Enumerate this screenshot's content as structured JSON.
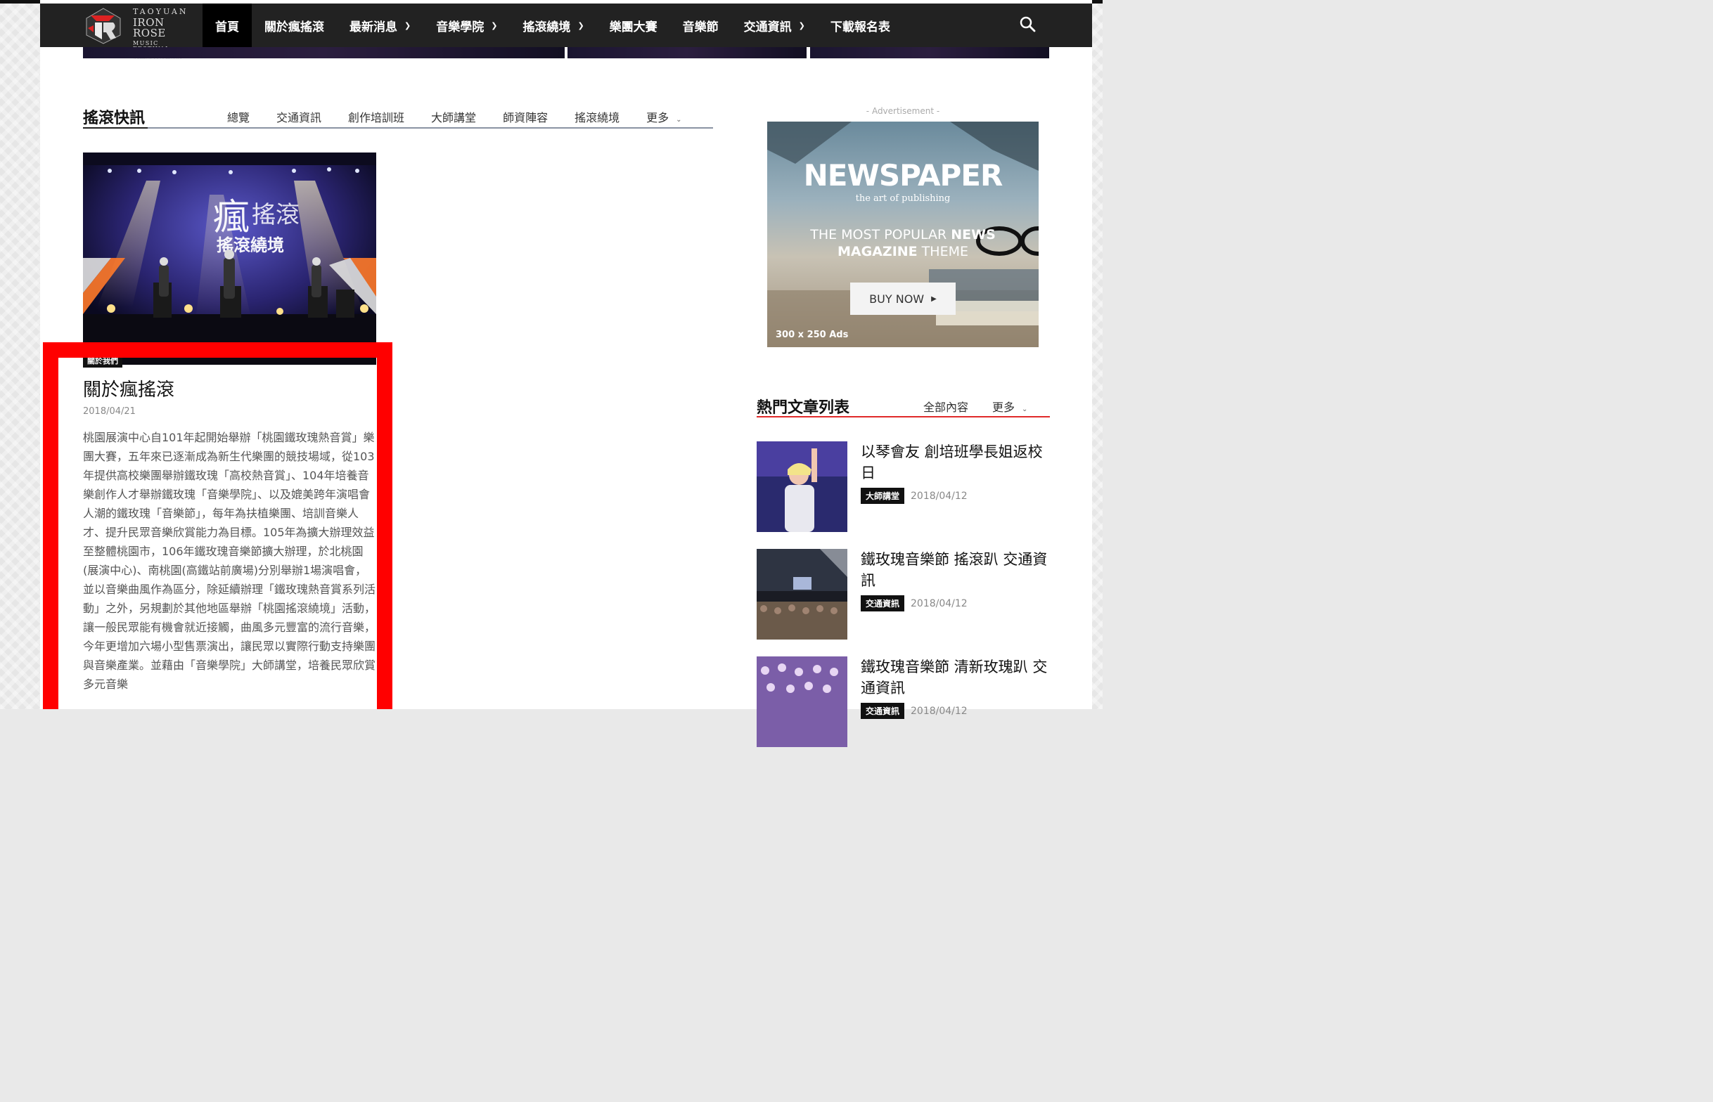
{
  "nav": {
    "logo": {
      "line1": "TAOYUAN",
      "line2": "IRON ROSE",
      "line3": "MUSIC FESTIVAL",
      "line4": "桃園鐵玫瑰音樂節"
    },
    "items": [
      {
        "label": "首頁",
        "active": true,
        "has_dropdown": false
      },
      {
        "label": "關於瘋搖滾",
        "active": false,
        "has_dropdown": false
      },
      {
        "label": "最新消息",
        "active": false,
        "has_dropdown": true
      },
      {
        "label": "音樂學院",
        "active": false,
        "has_dropdown": true
      },
      {
        "label": "搖滾繞境",
        "active": false,
        "has_dropdown": true
      },
      {
        "label": "樂團大賽",
        "active": false,
        "has_dropdown": false
      },
      {
        "label": "音樂節",
        "active": false,
        "has_dropdown": false
      },
      {
        "label": "交通資訊",
        "active": false,
        "has_dropdown": true
      },
      {
        "label": "下載報名表",
        "active": false,
        "has_dropdown": false
      }
    ],
    "search_icon": "search-icon"
  },
  "section": {
    "title": "搖滾快訊",
    "tabs": [
      "總覽",
      "交通資訊",
      "創作培訓班",
      "大師講堂",
      "師資陣容",
      "搖滾繞境"
    ],
    "more_label": "更多"
  },
  "featured": {
    "category": "關於我們",
    "title": "關於瘋搖滾",
    "date": "2018/04/21",
    "body": "桃園展演中心自101年起開始舉辦「桃園鐵玫瑰熱音賞」樂團大賽，五年來已逐漸成為新生代樂團的競技場域，從103年提供高校樂團舉辦鐵玫瑰「高校熱音賞」、104年培養音樂創作人才舉辦鐵玫瑰「音樂學院」、以及媲美跨年演唱會人潮的鐵玫瑰「音樂節」，每年為扶植樂團、培訓音樂人才、提升民眾音樂欣賞能力為目標。105年為擴大辦理效益至整體桃園市，106年鐵玫瑰音樂節擴大辦理，於北桃園(展演中心)、南桃園(高鐵站前廣場)分別舉辦1場演唱會，並以音樂曲風作為區分，除延續辦理「鐵玫瑰熱音賞系列活動」之外，另規劃於其他地區舉辦「桃園搖滾繞境」活動，讓一般民眾能有機會就近接觸，曲風多元豐富的流行音樂，今年更增加六場小型售票演出，讓民眾以實際行動支持樂團與音樂產業。並藉由「音樂學院」大師講堂，培養民眾欣賞多元音樂"
  },
  "ad": {
    "label": "- Advertisement -",
    "headline": "NEWSPAPER",
    "subline": "the art of publishing",
    "line1_a": "THE MOST POPULAR ",
    "line1_b": "NEWS",
    "line2_a": "MAGAZINE",
    "line2_b": " THEME",
    "button": "BUY NOW",
    "size": "300 x 250 Ads"
  },
  "popular": {
    "title": "熱門文章列表",
    "tab_all": "全部內容",
    "more_label": "更多",
    "items": [
      {
        "title": "以琴會友 創培班學長姐返校日",
        "category": "大師講堂",
        "date": "2018/04/12"
      },
      {
        "title": "鐵玫瑰音樂節 搖滾趴 交通資訊",
        "category": "交通資訊",
        "date": "2018/04/12"
      },
      {
        "title": "鐵玫瑰音樂節 清新玫瑰趴 交通資訊",
        "category": "交通資訊",
        "date": "2018/04/12"
      }
    ]
  },
  "colors": {
    "nav_bg": "#222222",
    "accent_red": "#e02a2a",
    "highlight_box": "#ff0000"
  }
}
